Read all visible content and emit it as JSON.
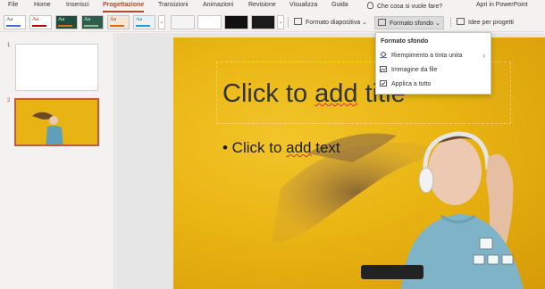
{
  "menu": {
    "tabs": [
      "File",
      "Home",
      "Inserisci",
      "Progettazione",
      "Transizioni",
      "Animazioni",
      "Revisione",
      "Visualizza",
      "Guida"
    ],
    "active_tab": "Progettazione",
    "tell_me": "Che cosa si vuole fare?",
    "open_in_app": "Apri in PowerPoint"
  },
  "ribbon": {
    "themes": [
      {
        "label": "Aa",
        "bg": "#ffffff",
        "fg": "#333333",
        "accent": "#4472c4"
      },
      {
        "label": "Aa",
        "bg": "#ffffff",
        "fg": "#c00000",
        "accent": "#c00000"
      },
      {
        "label": "Aa",
        "bg": "#1e4d3b",
        "fg": "#ffffff",
        "accent": "#e36c09"
      },
      {
        "label": "Aa",
        "bg": "#2e5e4e",
        "fg": "#ffffff",
        "accent": "#8fbc8f"
      },
      {
        "label": "Aa",
        "bg": "#f4e7d7",
        "fg": "#6b3b16",
        "accent": "#e36c09"
      },
      {
        "label": "Aa",
        "bg": "#e7f3f8",
        "fg": "#1f6e8c",
        "accent": "#2e9acb"
      }
    ],
    "variants": [
      "#f4f4f4",
      "#ffffff",
      "#111111",
      "#1b1b1b"
    ],
    "slide_size_label": "Formato diapositiva",
    "format_background_label": "Formato sfondo",
    "designer_label": "Idee per progetti"
  },
  "slides": [
    {
      "number": "1"
    },
    {
      "number": "2"
    }
  ],
  "slide": {
    "title_placeholder_before": "Click to ",
    "title_placeholder_mid": "add",
    "title_placeholder_after": " title",
    "body_placeholder_before": "• Click to ",
    "body_placeholder_mid": "add",
    "body_placeholder_after": " text"
  },
  "format_menu": {
    "header": "Formato sfondo",
    "items": [
      "Riempimento a tinta unita",
      "Immagine da file",
      "Applica a tutto"
    ]
  },
  "colors": {
    "accent": "#b7472a",
    "slide_bg": "#e9b512"
  }
}
